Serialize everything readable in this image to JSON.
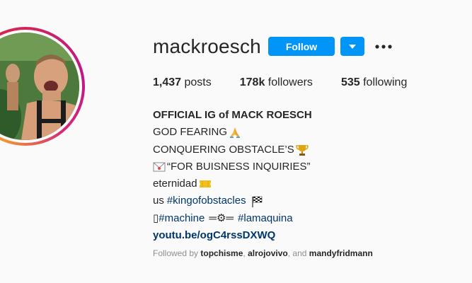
{
  "profile": {
    "username": "mackroesch",
    "follow_label": "Follow",
    "more_label": "•••",
    "stats": {
      "posts_count": "1,437",
      "posts_label": "posts",
      "followers_count": "178k",
      "followers_label": "followers",
      "following_count": "535",
      "following_label": "following"
    },
    "bio": {
      "name": "OFFICIAL IG of MACK ROESCH",
      "line1": "GOD FEARING",
      "line1_icon": "praying-hands-icon",
      "line2": "CONQUERING OBSTACLE’S",
      "line2_icon": "trophy-icon",
      "line3_icon": "envelope-icon",
      "line3": "“FOR BUISNESS INQUIRIES”",
      "line4": "eternidad",
      "line4_icon": "ticket-icon",
      "line5_prefix": "us ",
      "line5_hashtag": "#kingofobstacles",
      "line5_icon": "checkered-flag-icon",
      "line6_box": "▯",
      "line6_hashtag1": "#machine",
      "line6_mid": "═⚙═",
      "line6_hashtag2": "#lamaquina",
      "website": "youtu.be/ogC4rssDXWQ"
    },
    "followed_by": {
      "prefix": "Followed by ",
      "user1": "topchisme",
      "sep1": ", ",
      "user2": "alrojovivo",
      "sep2": ", and ",
      "user3": "mandyfridmann"
    },
    "colors": {
      "accent": "#0095f6",
      "link": "#00376b",
      "muted": "#8e8e8e"
    }
  }
}
